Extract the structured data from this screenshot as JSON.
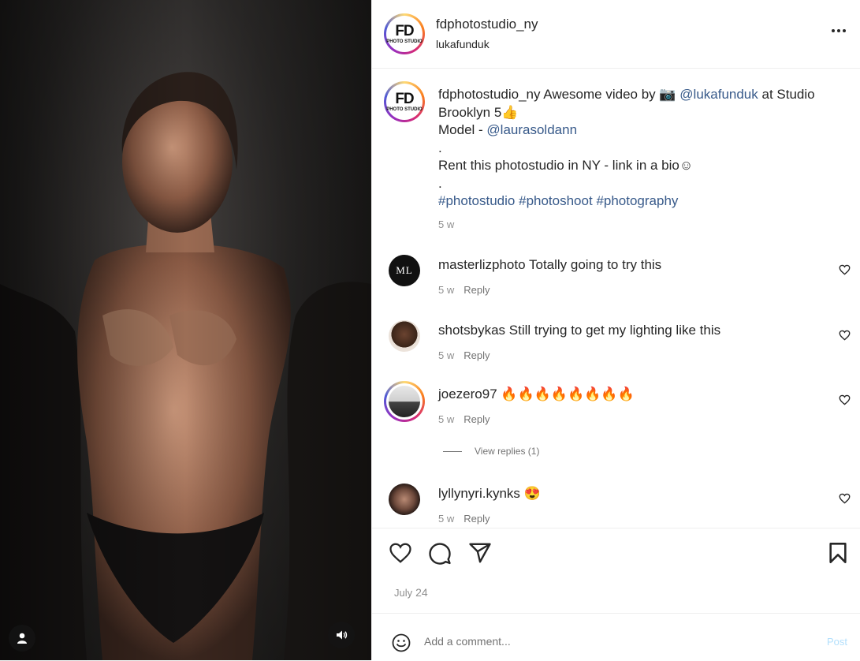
{
  "post": {
    "author": "fdphotostudio_ny",
    "audio_subtitle": "lukafunduk",
    "logo": {
      "fd": "FD",
      "photo_studio": "PHOTO STUDIO"
    }
  },
  "caption": {
    "username": "fdphotostudio_ny",
    "text_1": " Awesome video by 📷 ",
    "mention_1": "@lukafunduk",
    "text_2": " at Studio Brooklyn 5👍",
    "line_model_prefix": "Model - ",
    "mention_2": "@laurasoldann",
    "dot_1": ".",
    "line_rent": "Rent this photostudio in NY - link in a bio☺",
    "dot_2": ".",
    "hashtags": [
      "#photostudio",
      "#photoshoot",
      "#photography"
    ],
    "time": "5 w"
  },
  "comments": [
    {
      "username": "masterlizphoto",
      "text": "Totally going to try this",
      "time": "5 w",
      "reply": "Reply",
      "avatar_text": "ML"
    },
    {
      "username": "shotsbykas",
      "text": "Still trying to get my lighting like this",
      "time": "5 w",
      "reply": "Reply"
    },
    {
      "username": "joezero97",
      "text": "🔥🔥🔥🔥🔥🔥🔥🔥",
      "time": "5 w",
      "reply": "Reply"
    },
    {
      "username": "lyllynyri.kynks",
      "text": "😍",
      "time": "5 w",
      "reply": "Reply"
    }
  ],
  "view_replies": "View replies (1)",
  "date": {
    "month": "July",
    "day": "24"
  },
  "add_comment": {
    "placeholder": "Add a comment...",
    "post_label": "Post"
  },
  "colors": {
    "link": "#385a8a",
    "muted": "#8e8e8e",
    "post_disabled": "#b2dffc"
  }
}
